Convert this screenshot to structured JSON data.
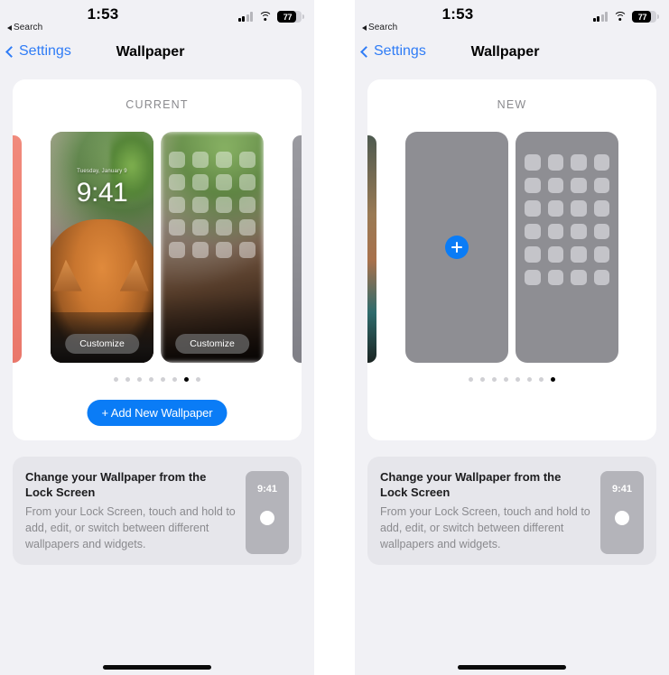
{
  "panels": [
    {
      "id": "current-state",
      "status_bar": {
        "back_label": "Search",
        "time": "1:53",
        "battery_percent": "77",
        "signal_icon": "cellular-bars-icon",
        "wifi_icon": "wifi-icon",
        "battery_icon": "battery-icon"
      },
      "nav": {
        "back_label": "Settings",
        "title": "Wallpaper"
      },
      "gallery": {
        "section_label": "CURRENT",
        "lock_preview": {
          "date": "Tuesday, January 9",
          "time": "9:41",
          "customize_label": "Customize"
        },
        "home_preview": {
          "customize_label": "Customize"
        },
        "dots_total": 8,
        "dots_active_index": 6,
        "add_button_label": "+ Add New Wallpaper"
      },
      "info": {
        "title": "Change your Wallpaper from the Lock Screen",
        "body": "From your Lock Screen, touch and hold to add, edit, or switch between different wallpapers and widgets.",
        "thumb_time": "9:41"
      }
    },
    {
      "id": "new-state",
      "status_bar": {
        "back_label": "Search",
        "time": "1:53",
        "battery_percent": "77",
        "signal_icon": "cellular-bars-icon",
        "wifi_icon": "wifi-icon",
        "battery_icon": "battery-icon"
      },
      "nav": {
        "back_label": "Settings",
        "title": "Wallpaper"
      },
      "gallery": {
        "section_label": "NEW",
        "add_icon": "plus-icon",
        "dots_total": 8,
        "dots_active_index": 7
      },
      "info": {
        "title": "Change your Wallpaper from the Lock Screen",
        "body": "From your Lock Screen, touch and hold to add, edit, or switch between different wallpapers and widgets.",
        "thumb_time": "9:41"
      }
    }
  ],
  "colors": {
    "accent_blue": "#0a7cf6",
    "link_blue": "#2f7cf6",
    "page_bg": "#f1f1f5",
    "card_bg": "#ffffff",
    "info_card_bg": "#e6e6eb",
    "placeholder_gray": "#8e8e93",
    "muted_text": "#8a8a8e"
  }
}
